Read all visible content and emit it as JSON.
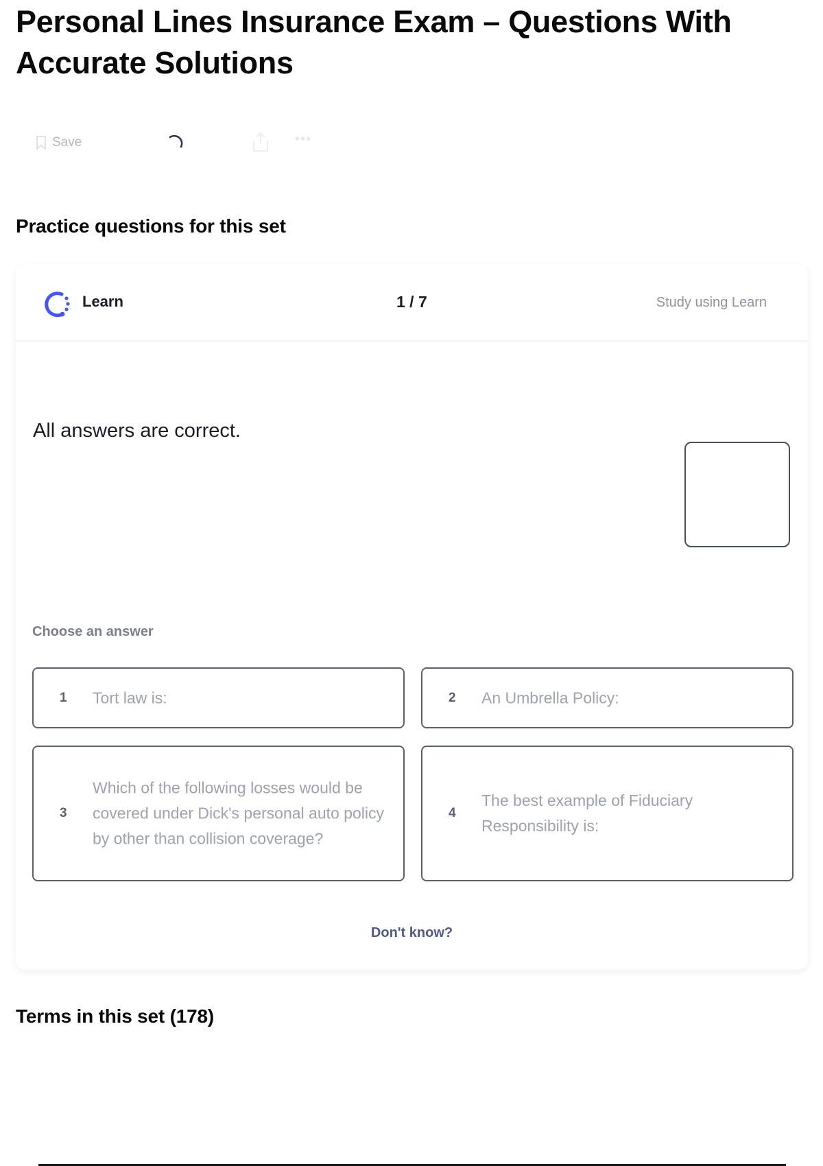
{
  "page": {
    "title": "Personal Lines Insurance Exam – Questions With Accurate Solutions"
  },
  "toolbar": {
    "save_label": "Save",
    "icons": [
      "bookmark-icon",
      "loading-spinner-icon",
      "share-icon",
      "more-icon"
    ]
  },
  "practice": {
    "heading": "Practice questions for this set",
    "mode_label": "Learn",
    "progress": "1 / 7",
    "study_link": "Study using Learn",
    "question": "All answers are correct.",
    "choose_label": "Choose an answer",
    "options": [
      {
        "number": "1",
        "text": "Tort law is:"
      },
      {
        "number": "2",
        "text": "An Umbrella Policy:"
      },
      {
        "number": "3",
        "text": "Which of the following losses would be covered under Dick's personal auto policy by other than collision coverage?"
      },
      {
        "number": "4",
        "text": "The best example of Fiduciary Responsibility is:"
      }
    ],
    "dont_know": "Don't know?"
  },
  "terms": {
    "heading": "Terms in this set (178)"
  },
  "colors": {
    "accent": "#4255ff",
    "border": "#5b6071",
    "muted_text": "#9ea2af",
    "link": "#4e5a8c"
  }
}
